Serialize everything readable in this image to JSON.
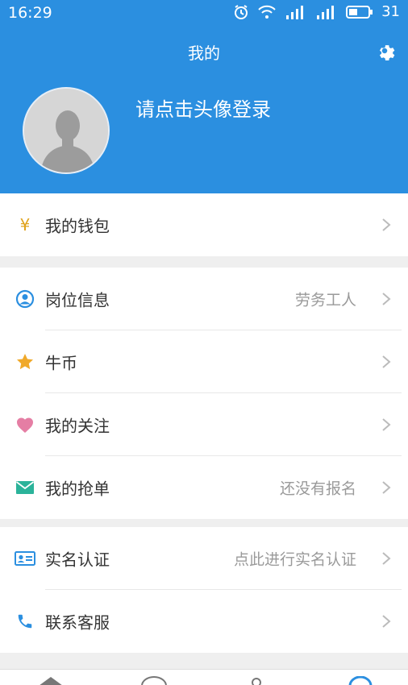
{
  "status_bar": {
    "time": "16:29",
    "battery": "31"
  },
  "header": {
    "title": "我的",
    "login_prompt": "请点击头像登录"
  },
  "groups": [
    {
      "items": [
        {
          "label": "我的钱包",
          "value": "",
          "icon": "yen-icon"
        }
      ]
    },
    {
      "items": [
        {
          "label": "岗位信息",
          "value": "劳务工人",
          "icon": "person-circle-icon"
        },
        {
          "label": "牛币",
          "value": "",
          "icon": "star-icon"
        },
        {
          "label": "我的关注",
          "value": "",
          "icon": "heart-icon"
        },
        {
          "label": "我的抢单",
          "value": "还没有报名",
          "icon": "envelope-icon"
        }
      ]
    },
    {
      "items": [
        {
          "label": "实名认证",
          "value": "点此进行实名认证",
          "icon": "id-card-icon"
        },
        {
          "label": "联系客服",
          "value": "",
          "icon": "phone-icon"
        }
      ]
    }
  ],
  "colors": {
    "header": "#2b8fe0",
    "yen": "#e0a21b",
    "person": "#2b8fe0",
    "star": "#f0a92a",
    "heart": "#e57ea4",
    "envelope": "#2bb39a",
    "idcard": "#2b8fe0",
    "phone": "#2b8fe0"
  }
}
